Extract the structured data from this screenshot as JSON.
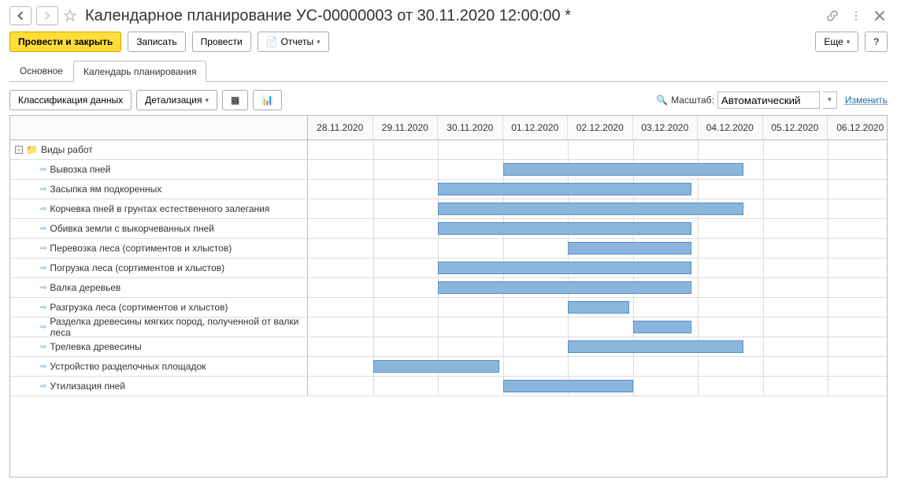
{
  "header": {
    "title": "Календарное планирование УС-00000003 от 30.11.2020 12:00:00 *"
  },
  "toolbar": {
    "submit_close": "Провести и закрыть",
    "save": "Записать",
    "submit": "Провести",
    "reports": "Отчеты",
    "more": "Еще"
  },
  "tabs": {
    "main": "Основное",
    "calendar": "Календарь планирования"
  },
  "sub_toolbar": {
    "classify": "Классификация данных",
    "detail": "Детализация",
    "scale_label": "Масштаб:",
    "scale_value": "Автоматический",
    "change": "Изменить"
  },
  "dates": [
    "28.11.2020",
    "29.11.2020",
    "30.11.2020",
    "01.12.2020",
    "02.12.2020",
    "03.12.2020",
    "04.12.2020",
    "05.12.2020",
    "06.12.2020"
  ],
  "root": "Виды работ",
  "tasks": [
    {
      "name": "Вывозка пней",
      "start": 3,
      "end": 6.7
    },
    {
      "name": "Засыпка ям подкоренных",
      "start": 2,
      "end": 5.9
    },
    {
      "name": "Корчевка пней в грунтах естественного залегания",
      "start": 2,
      "end": 6.7
    },
    {
      "name": "Обивка земли с выкорчеванных пней",
      "start": 2,
      "end": 5.9
    },
    {
      "name": "Перевозка леса (сортиментов и хлыстов)",
      "start": 4,
      "end": 5.9
    },
    {
      "name": "Погрузка леса (сортиментов и хлыстов)",
      "start": 2,
      "end": 5.9
    },
    {
      "name": "Валка деревьев",
      "start": 2,
      "end": 5.9
    },
    {
      "name": "Разгрузка леса (сортиментов и хлыстов)",
      "start": 4,
      "end": 4.95
    },
    {
      "name": "Разделка древесины мягких пород, полученной от валки леса",
      "start": 5,
      "end": 5.9
    },
    {
      "name": "Трелевка древесины",
      "start": 4,
      "end": 6.7
    },
    {
      "name": "Устройство разделочных площадок",
      "start": 1,
      "end": 2.95
    },
    {
      "name": "Утилизация пней",
      "start": 3,
      "end": 5.0
    }
  ],
  "chart_data": {
    "type": "gantt",
    "x_axis": [
      "28.11.2020",
      "29.11.2020",
      "30.11.2020",
      "01.12.2020",
      "02.12.2020",
      "03.12.2020",
      "04.12.2020",
      "05.12.2020",
      "06.12.2020"
    ],
    "series": [
      {
        "name": "Вывозка пней",
        "start": "01.12.2020",
        "end": "04.12.2020"
      },
      {
        "name": "Засыпка ям подкоренных",
        "start": "30.11.2020",
        "end": "03.12.2020"
      },
      {
        "name": "Корчевка пней в грунтах естественного залегания",
        "start": "30.11.2020",
        "end": "04.12.2020"
      },
      {
        "name": "Обивка земли с выкорчеванных пней",
        "start": "30.11.2020",
        "end": "03.12.2020"
      },
      {
        "name": "Перевозка леса (сортиментов и хлыстов)",
        "start": "02.12.2020",
        "end": "03.12.2020"
      },
      {
        "name": "Погрузка леса (сортиментов и хлыстов)",
        "start": "30.11.2020",
        "end": "03.12.2020"
      },
      {
        "name": "Валка деревьев",
        "start": "30.11.2020",
        "end": "03.12.2020"
      },
      {
        "name": "Разгрузка леса (сортиментов и хлыстов)",
        "start": "02.12.2020",
        "end": "02.12.2020"
      },
      {
        "name": "Разделка древесины мягких пород, полученной от валки леса",
        "start": "03.12.2020",
        "end": "03.12.2020"
      },
      {
        "name": "Трелевка древесины",
        "start": "02.12.2020",
        "end": "04.12.2020"
      },
      {
        "name": "Устройство разделочных площадок",
        "start": "29.11.2020",
        "end": "30.11.2020"
      },
      {
        "name": "Утилизация пней",
        "start": "01.12.2020",
        "end": "03.12.2020"
      }
    ]
  }
}
